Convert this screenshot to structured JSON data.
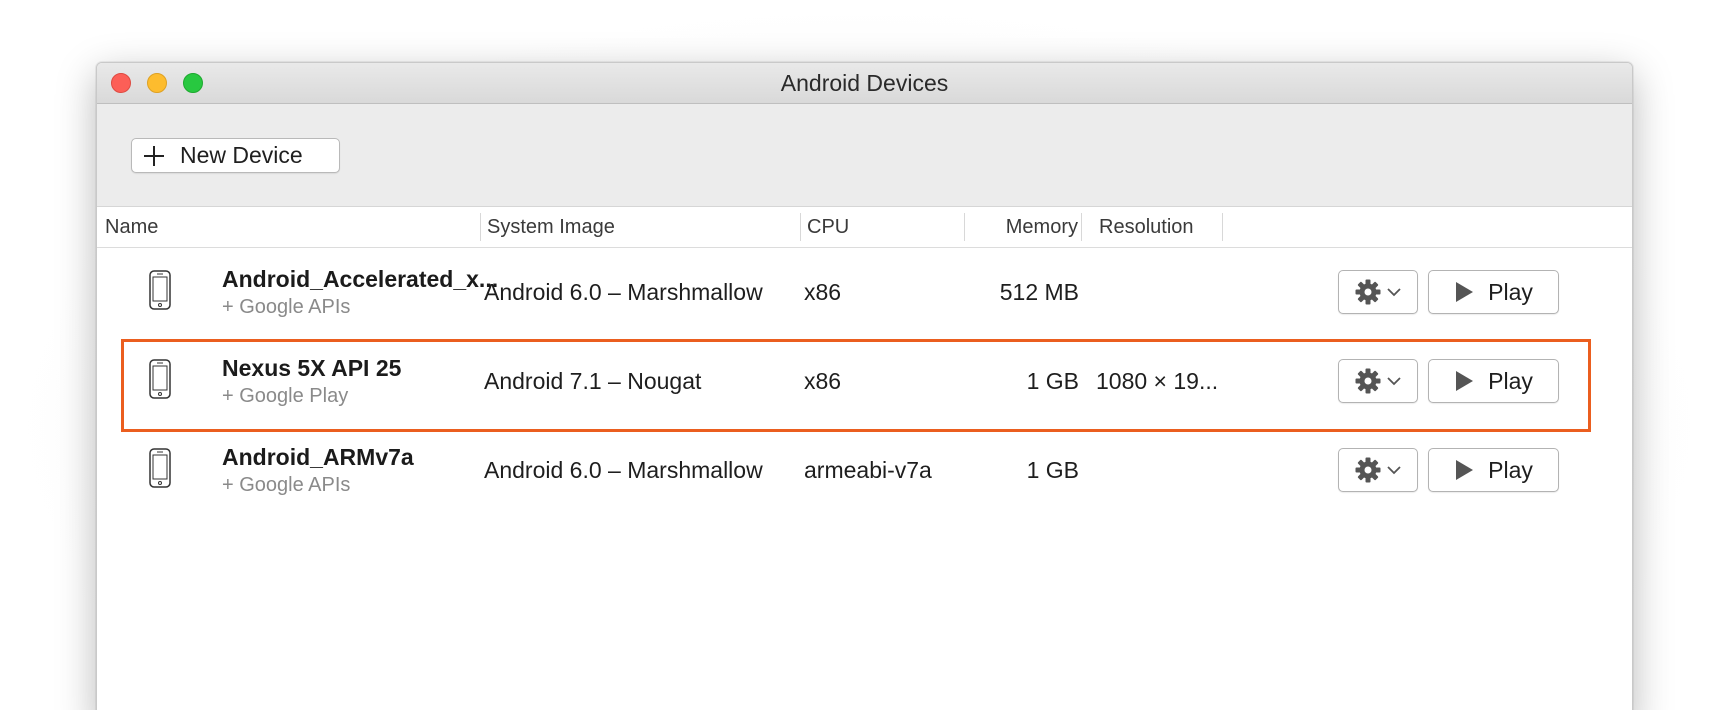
{
  "window": {
    "title": "Android Devices"
  },
  "toolbar": {
    "new_device_label": "New Device",
    "new_device_icon": "plus-icon"
  },
  "table": {
    "columns": [
      "Name",
      "System Image",
      "CPU",
      "Memory",
      "Resolution"
    ],
    "rows": [
      {
        "name": "Android_Accelerated_x...",
        "subtitle": "+ Google APIs",
        "system_image": "Android 6.0 – Marshmallow",
        "cpu": "x86",
        "memory": "512 MB",
        "resolution": "",
        "play_label": "Play",
        "selected": false
      },
      {
        "name": "Nexus 5X API 25",
        "subtitle": "+ Google Play",
        "system_image": "Android 7.1 – Nougat",
        "cpu": "x86",
        "memory": "1 GB",
        "resolution": "1080 × 19...",
        "play_label": "Play",
        "selected": true
      },
      {
        "name": "Android_ARMv7a",
        "subtitle": "+ Google APIs",
        "system_image": "Android 6.0 – Marshmallow",
        "cpu": "armeabi-v7a",
        "memory": "1 GB",
        "resolution": "",
        "play_label": "Play",
        "selected": false
      }
    ]
  },
  "colors": {
    "selection_outline": "#eb5e1f",
    "close": "#fc5f57",
    "minimize": "#fdbc2e",
    "maximize": "#28c840"
  },
  "icons": {
    "device": "phone-icon",
    "settings": "gear-icon",
    "menu": "chevron-down-icon",
    "play": "play-icon"
  }
}
